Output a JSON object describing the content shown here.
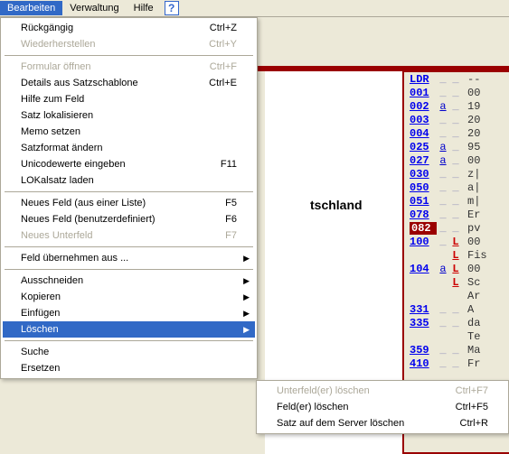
{
  "menubar": {
    "items": [
      {
        "label": "Bearbeiten",
        "active": true
      },
      {
        "label": "Verwaltung",
        "active": false
      },
      {
        "label": "Hilfe",
        "active": false
      }
    ],
    "help_icon": "?"
  },
  "dropdown": {
    "groups": [
      [
        {
          "label": "Rückgängig",
          "shortcut": "Ctrl+Z",
          "disabled": false,
          "arrow": false
        },
        {
          "label": "Wiederherstellen",
          "shortcut": "Ctrl+Y",
          "disabled": true,
          "arrow": false
        }
      ],
      [
        {
          "label": "Formular öffnen",
          "shortcut": "Ctrl+F",
          "disabled": true,
          "arrow": false
        },
        {
          "label": "Details aus Satzschablone",
          "shortcut": "Ctrl+E",
          "disabled": false,
          "arrow": false
        },
        {
          "label": "Hilfe zum Feld",
          "shortcut": "",
          "disabled": false,
          "arrow": false
        },
        {
          "label": "Satz lokalisieren",
          "shortcut": "",
          "disabled": false,
          "arrow": false
        },
        {
          "label": "Memo setzen",
          "shortcut": "",
          "disabled": false,
          "arrow": false
        },
        {
          "label": "Satzformat ändern",
          "shortcut": "",
          "disabled": false,
          "arrow": false
        },
        {
          "label": "Unicodewerte eingeben",
          "shortcut": "F11",
          "disabled": false,
          "arrow": false
        },
        {
          "label": "LOKalsatz laden",
          "shortcut": "",
          "disabled": false,
          "arrow": false
        }
      ],
      [
        {
          "label": "Neues Feld (aus einer Liste)",
          "shortcut": "F5",
          "disabled": false,
          "arrow": false
        },
        {
          "label": "Neues Feld (benutzerdefiniert)",
          "shortcut": "F6",
          "disabled": false,
          "arrow": false
        },
        {
          "label": "Neues Unterfeld",
          "shortcut": "F7",
          "disabled": true,
          "arrow": false
        }
      ],
      [
        {
          "label": "Feld übernehmen aus ...",
          "shortcut": "",
          "disabled": false,
          "arrow": true
        }
      ],
      [
        {
          "label": "Ausschneiden",
          "shortcut": "",
          "disabled": false,
          "arrow": true
        },
        {
          "label": "Kopieren",
          "shortcut": "",
          "disabled": false,
          "arrow": true
        },
        {
          "label": "Einfügen",
          "shortcut": "",
          "disabled": false,
          "arrow": true
        },
        {
          "label": "Löschen",
          "shortcut": "",
          "disabled": false,
          "arrow": true,
          "highlighted": true
        }
      ],
      [
        {
          "label": "Suche",
          "shortcut": "",
          "disabled": false,
          "arrow": false
        },
        {
          "label": "Ersetzen",
          "shortcut": "",
          "disabled": false,
          "arrow": false
        }
      ]
    ]
  },
  "submenu": {
    "items": [
      {
        "label": "Unterfeld(er) löschen",
        "shortcut": "Ctrl+F7",
        "disabled": true
      },
      {
        "label": "Feld(er) löschen",
        "shortcut": "Ctrl+F5",
        "disabled": false
      },
      {
        "label": "Satz auf dem Server löschen",
        "shortcut": "Ctrl+R",
        "disabled": false
      }
    ]
  },
  "content": {
    "text": "tschland"
  },
  "fields": [
    {
      "tag": "LDR",
      "ind1": "",
      "ind2": "",
      "val": "--",
      "hl": false
    },
    {
      "tag": "001",
      "ind1": "",
      "ind2": "",
      "val": "00",
      "hl": false
    },
    {
      "tag": "002",
      "ind1": "a",
      "ind2": "",
      "val": "19",
      "hl": false
    },
    {
      "tag": "003",
      "ind1": "",
      "ind2": "",
      "val": "20",
      "hl": false
    },
    {
      "tag": "004",
      "ind1": "",
      "ind2": "",
      "val": "20",
      "hl": false
    },
    {
      "tag": "025",
      "ind1": "a",
      "ind2": "",
      "val": "95",
      "hl": false
    },
    {
      "tag": "027",
      "ind1": "a",
      "ind2": "",
      "val": "00",
      "hl": false
    },
    {
      "tag": "030",
      "ind1": "",
      "ind2": "",
      "val": "z|",
      "hl": false
    },
    {
      "tag": "050",
      "ind1": "",
      "ind2": "",
      "val": "a|",
      "hl": false
    },
    {
      "tag": "051",
      "ind1": "",
      "ind2": "",
      "val": "m|",
      "hl": false
    },
    {
      "tag": "078",
      "ind1": "",
      "ind2": "",
      "val": "Er",
      "hl": false
    },
    {
      "tag": "082",
      "ind1": "",
      "ind2": "",
      "val": "pv",
      "hl": true
    },
    {
      "tag": "100",
      "ind1": "",
      "ind2": "L",
      "val": "00",
      "hl": false,
      "ind2hl": true
    },
    {
      "tag": "",
      "ind1": "",
      "ind2": "L",
      "val": "Fis",
      "hl": false,
      "ind2hl": true,
      "cont": true
    },
    {
      "tag": "104",
      "ind1": "a",
      "ind2": "L",
      "val": "00",
      "hl": false,
      "ind2hl": true
    },
    {
      "tag": "",
      "ind1": "",
      "ind2": "L",
      "val": "Sc",
      "hl": false,
      "ind2hl": true,
      "cont": true
    },
    {
      "tag": "",
      "ind1": "",
      "ind2": "",
      "val": "Ar",
      "hl": false,
      "cont": true
    },
    {
      "tag": "331",
      "ind1": "",
      "ind2": "",
      "val": "A",
      "hl": false
    },
    {
      "tag": "335",
      "ind1": "",
      "ind2": "",
      "val": "da",
      "hl": false
    },
    {
      "tag": "",
      "ind1": "",
      "ind2": "",
      "val": "Te",
      "hl": false,
      "cont": true
    },
    {
      "tag": "359",
      "ind1": "",
      "ind2": "",
      "val": "Ma",
      "hl": false
    },
    {
      "tag": "410",
      "ind1": "",
      "ind2": "",
      "val": "Fr",
      "hl": false
    }
  ]
}
